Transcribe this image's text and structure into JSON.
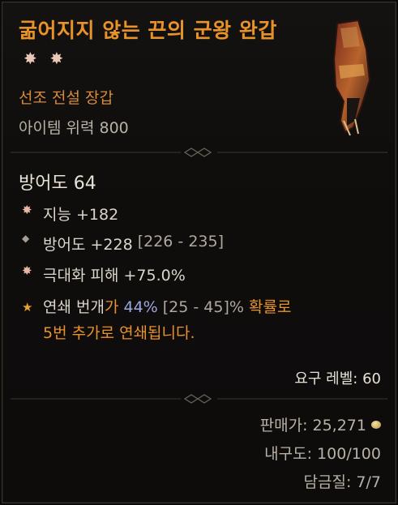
{
  "item": {
    "name": "굶어지지 않는 끈의 군왕 완갑",
    "type": "선조 전설 장갑",
    "power": "아이템 위력 800",
    "armor": "방어도 64"
  },
  "affixes": [
    {
      "icon": "star-icon",
      "text": "지능 +182"
    },
    {
      "icon": "diamond-icon",
      "text_a": "방어도 +228",
      "text_b": "[226 - 235]"
    },
    {
      "icon": "star-icon",
      "text": "극대화 피해 +75.0%"
    },
    {
      "icon": "legendary-star-icon",
      "line1_a": "연쇄 번개",
      "line1_b": "가 ",
      "line1_c": "44%",
      "line1_d": " [25 - 45]%",
      "line1_e": " 확률로",
      "line2": "5번 추가로 연쇄됩니다."
    }
  ],
  "requirement": "요구 레벨: 60",
  "footer": {
    "sell_price": "판매가: 25,271",
    "durability": "내구도: 100/100",
    "tempering": "담금질: 7/7"
  },
  "colors": {
    "legendary_orange": "#e8922a",
    "value_blue": "#9da7e0"
  }
}
